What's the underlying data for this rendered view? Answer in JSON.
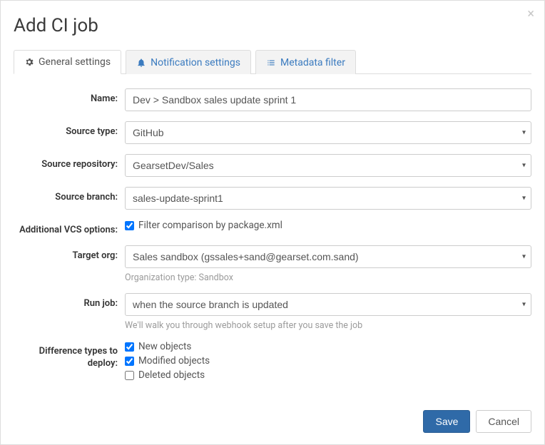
{
  "modal": {
    "title": "Add CI job"
  },
  "tabs": {
    "general": "General settings",
    "notification": "Notification settings",
    "metadata": "Metadata filter"
  },
  "labels": {
    "name": "Name:",
    "sourceType": "Source type:",
    "sourceRepo": "Source repository:",
    "sourceBranch": "Source branch:",
    "vcsOptions": "Additional VCS options:",
    "targetOrg": "Target org:",
    "runJob": "Run job:",
    "diffTypes": "Difference types to deploy:"
  },
  "values": {
    "name": "Dev > Sandbox sales update sprint 1",
    "sourceType": "GitHub",
    "sourceRepo": "GearsetDev/Sales",
    "sourceBranch": "sales-update-sprint1",
    "vcsFilter": "Filter comparison by package.xml",
    "targetOrg": "Sales sandbox (gssales+sand@gearset.com.sand)",
    "orgTypeHelp": "Organization type: Sandbox",
    "runJob": "when the source branch is updated",
    "runJobHelp": "We'll walk you through webhook setup after you save the job",
    "newObjects": "New objects",
    "modifiedObjects": "Modified objects",
    "deletedObjects": "Deleted objects"
  },
  "buttons": {
    "save": "Save",
    "cancel": "Cancel"
  }
}
